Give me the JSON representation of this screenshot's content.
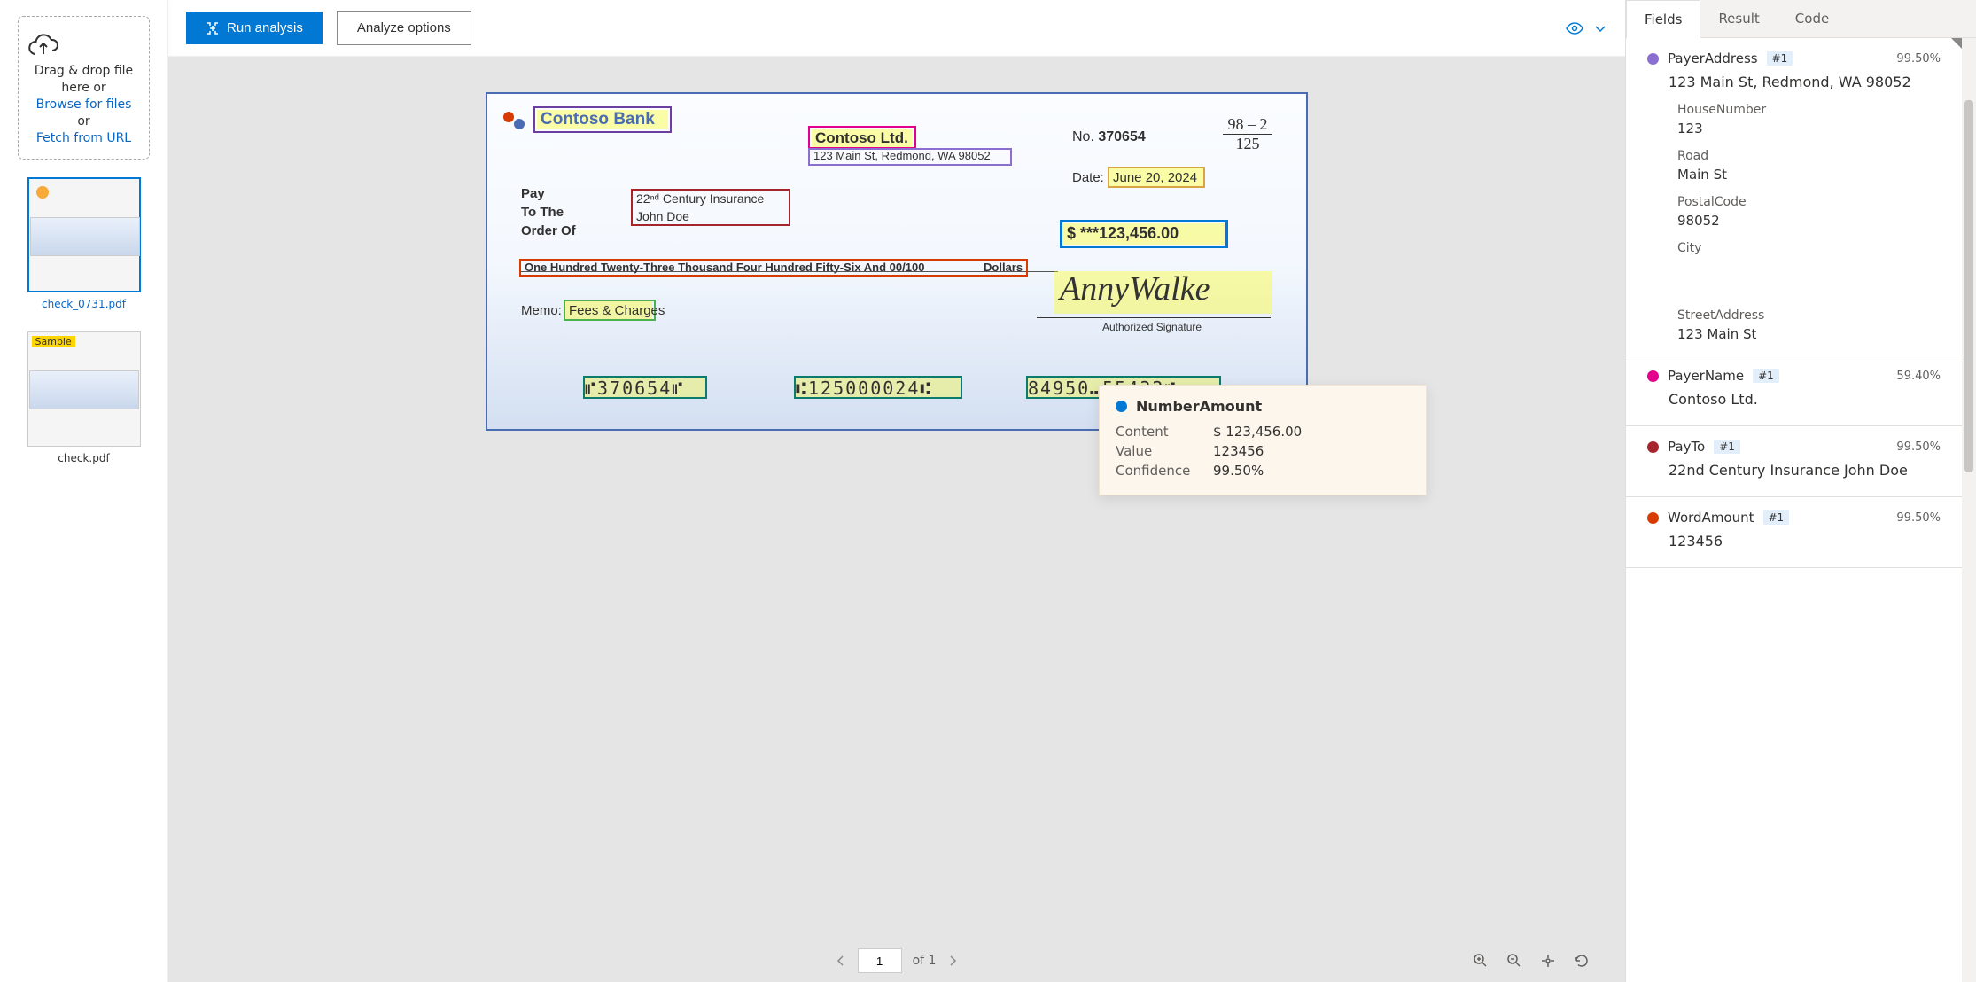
{
  "dropzone": {
    "line1": "Drag & drop file",
    "line2": "here or",
    "browse": "Browse for files",
    "or": "or",
    "fetch": "Fetch from URL"
  },
  "thumbnails": [
    {
      "label": "check_0731.pdf",
      "active": true,
      "dot": true
    },
    {
      "label": "check.pdf",
      "active": false,
      "sample": "Sample"
    }
  ],
  "toolbar": {
    "run": "Run analysis",
    "options": "Analyze options"
  },
  "check": {
    "bank": "Contoso Bank",
    "payer_name": "Contoso Ltd.",
    "payer_address": "123 Main St, Redmond, WA 98052",
    "no_label": "No.",
    "no_value": "370654",
    "routing_frac_top": "98 – 2",
    "routing_frac_bottom": "125",
    "date_label": "Date:",
    "date_value": "June 20, 2024",
    "pay_l1": "Pay",
    "pay_l2": "To The",
    "pay_l3": "Order Of",
    "payto_l1": "22ⁿᵈ Century Insurance",
    "payto_l2": "John Doe",
    "amount_box": "$   ***123,456.00",
    "amount_words": "One Hundred Twenty-Three Thousand Four Hundred Fifty-Six And 00/100",
    "dollars": "Dollars",
    "memo_label": "Memo:",
    "memo_value": "Fees & Charges",
    "signature": "AnnyWalke",
    "sig_label": "Authorized Signature",
    "micr1": "⑈370654⑈",
    "micr2": "⑆125000024⑆",
    "micr3": "84950⑉55432⑈"
  },
  "tooltip": {
    "title": "NumberAmount",
    "content_k": "Content",
    "content_v": "$ 123,456.00",
    "value_k": "Value",
    "value_v": "123456",
    "conf_k": "Confidence",
    "conf_v": "99.50%"
  },
  "tabs": {
    "fields": "Fields",
    "result": "Result",
    "code": "Code"
  },
  "fields": {
    "payerAddress": {
      "name": "PayerAddress",
      "badge": "#1",
      "conf": "99.50%",
      "value": "123 Main St, Redmond, WA 98052",
      "sub": [
        {
          "label": "HouseNumber",
          "value": "123"
        },
        {
          "label": "Road",
          "value": "Main St"
        },
        {
          "label": "PostalCode",
          "value": "98052"
        },
        {
          "label": "City",
          "value": ""
        },
        {
          "label": "StreetAddress",
          "value": "123 Main St"
        }
      ]
    },
    "payerName": {
      "name": "PayerName",
      "badge": "#1",
      "conf": "59.40%",
      "value": "Contoso Ltd."
    },
    "payTo": {
      "name": "PayTo",
      "badge": "#1",
      "conf": "99.50%",
      "value": "22nd Century Insurance John Doe"
    },
    "wordAmount": {
      "name": "WordAmount",
      "badge": "#1",
      "conf": "99.50%",
      "value": "123456"
    }
  },
  "pager": {
    "page": "1",
    "of": "of 1"
  },
  "colors": {
    "payerAddress": "#8a6fd1",
    "payerName": "#e3008c",
    "payTo": "#a4262c",
    "wordAmount": "#d83b01"
  }
}
